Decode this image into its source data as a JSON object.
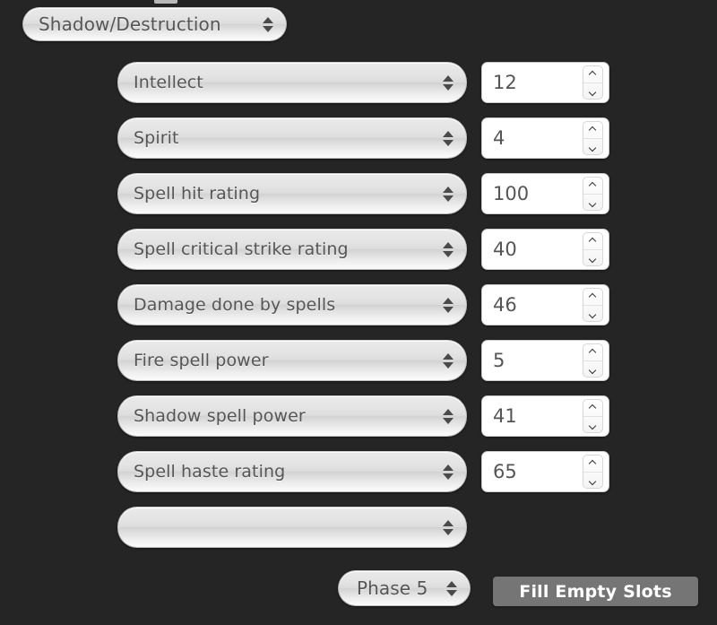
{
  "window": {
    "background_color": "#252525"
  },
  "header": {
    "profile_select": {
      "value": "Shadow/Destruction",
      "icon": "updown-arrows-icon"
    }
  },
  "stats": {
    "rows": [
      {
        "stat": "Intellect",
        "value": "12"
      },
      {
        "stat": "Spirit",
        "value": "4"
      },
      {
        "stat": "Spell hit rating",
        "value": "100"
      },
      {
        "stat": "Spell critical strike rating",
        "value": "40"
      },
      {
        "stat": "Damage done by spells",
        "value": "46"
      },
      {
        "stat": "Fire spell power",
        "value": "5"
      },
      {
        "stat": "Shadow spell power",
        "value": "41"
      },
      {
        "stat": "Spell haste rating",
        "value": "65"
      }
    ],
    "empty_row": {
      "stat": "",
      "icon": "updown-arrows-icon"
    },
    "spinner": {
      "up_icon": "chevron-up-icon",
      "down_icon": "chevron-down-icon"
    }
  },
  "footer": {
    "phase_select": {
      "value": "Phase 5",
      "icon": "updown-arrows-icon"
    },
    "fill_button": {
      "label": "Fill Empty Slots",
      "background_color": "#757575",
      "text_color": "#ffffff"
    }
  }
}
